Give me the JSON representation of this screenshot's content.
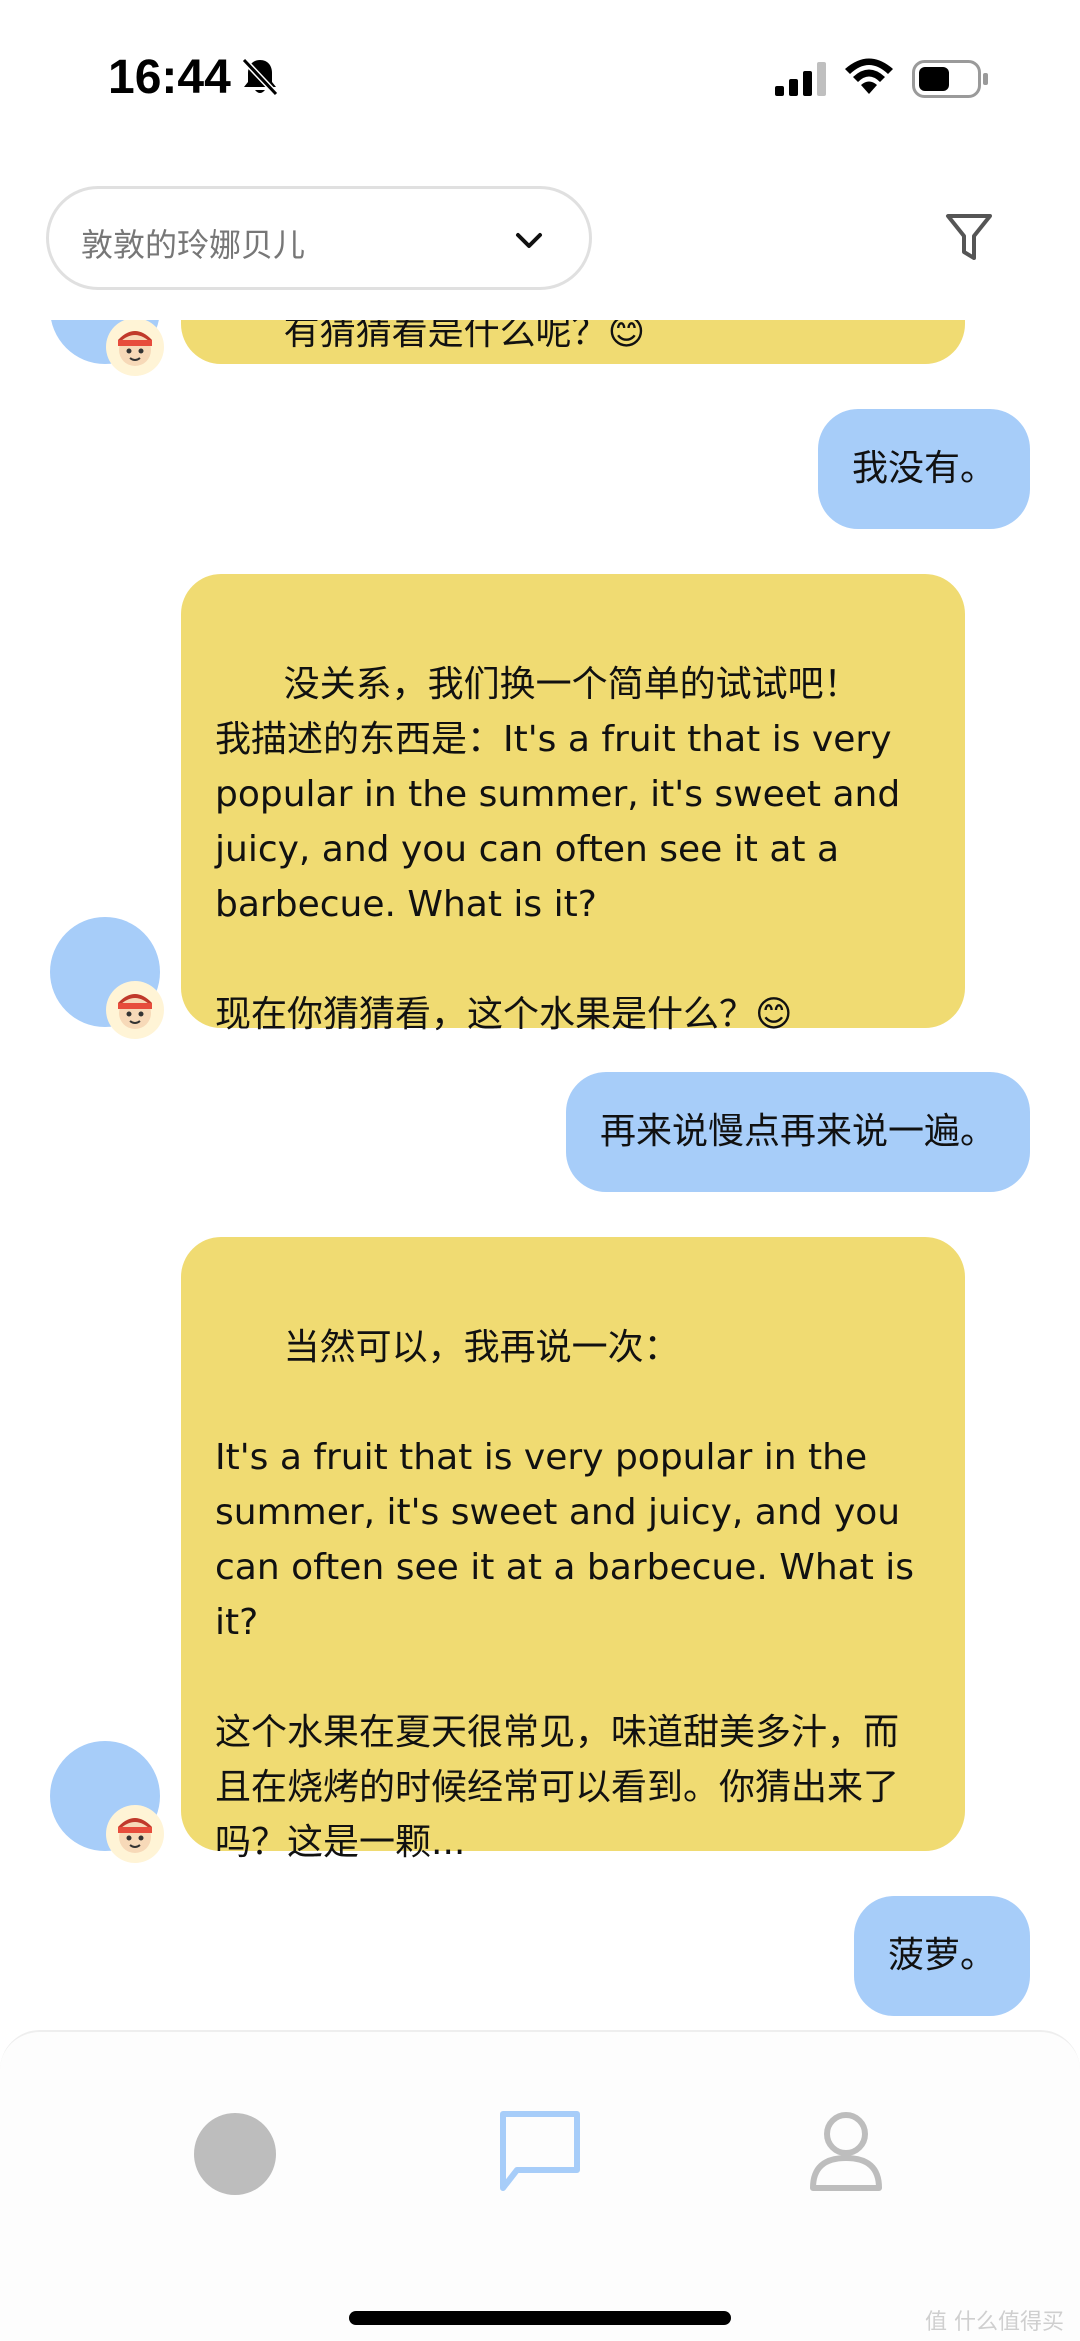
{
  "status_bar": {
    "time": "16:44",
    "icons": [
      "bell-slash-icon",
      "cellular-signal-icon",
      "wifi-icon",
      "battery-icon"
    ]
  },
  "header": {
    "partner_name": "敦敦的玲娜贝儿",
    "dropdown_icon": "chevron-down-icon",
    "filter_icon": "filter-icon"
  },
  "messages": [
    {
      "role": "ai",
      "text": "有猜猜看是什么呢？😊",
      "partial": true
    },
    {
      "role": "user",
      "text": "我没有。"
    },
    {
      "role": "ai",
      "text": "没关系，我们换一个简单的试试吧！\n我描述的东西是：It's a fruit that is very popular in the summer, it's sweet and juicy, and you can often see it at a barbecue. What is it?\n\n现在你猜猜看，这个水果是什么？😊"
    },
    {
      "role": "user",
      "text": "再来说慢点再来说一遍。"
    },
    {
      "role": "ai",
      "text": "当然可以，我再说一次：\n\nIt's a fruit that is very popular in the summer, it's sweet and juicy, and you can often see it at a barbecue. What is it?\n\n这个水果在夏天很常见，味道甜美多汁，而且在烧烤的时候经常可以看到。你猜出来了吗？这是一颗..."
    },
    {
      "role": "user",
      "text": "菠萝。"
    }
  ],
  "bottom_nav": {
    "items": [
      {
        "name": "home",
        "icon": "circle-icon"
      },
      {
        "name": "chat",
        "icon": "chat-bubble-icon",
        "active": true
      },
      {
        "name": "profile",
        "icon": "person-icon"
      }
    ]
  },
  "watermark": "值 什么值得买",
  "colors": {
    "ai_bubble": "#f0db72",
    "user_bubble": "#a7cdf9",
    "nav_active": "#a7cdf9",
    "nav_inactive": "#bdbdbd"
  }
}
